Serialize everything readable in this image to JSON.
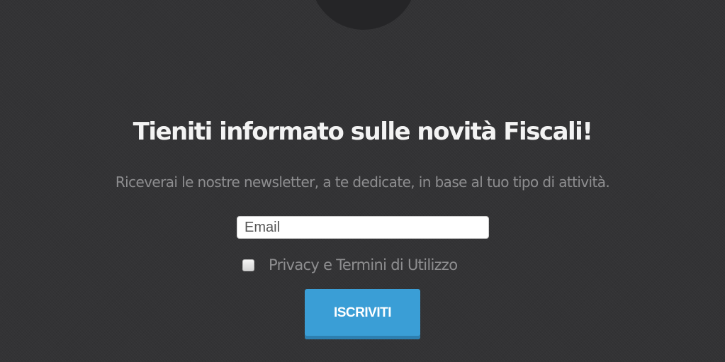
{
  "newsletter": {
    "title": "Tieniti informato sulle novità Fiscali!",
    "subtitle": "Riceverai le nostre newsletter, a te dedicate, in base al tuo tipo di attività.",
    "email": {
      "value": "",
      "placeholder": "Email"
    },
    "privacy": {
      "label": "Privacy e Termini di Utilizzo",
      "checked": false
    },
    "subscribe_label": "ISCRIVITI"
  },
  "colors": {
    "background": "#333335",
    "title": "#f3f3f3",
    "muted_text": "#8e8e90",
    "button": "#3a9ed6",
    "button_shadow": "#2d7fb0"
  }
}
